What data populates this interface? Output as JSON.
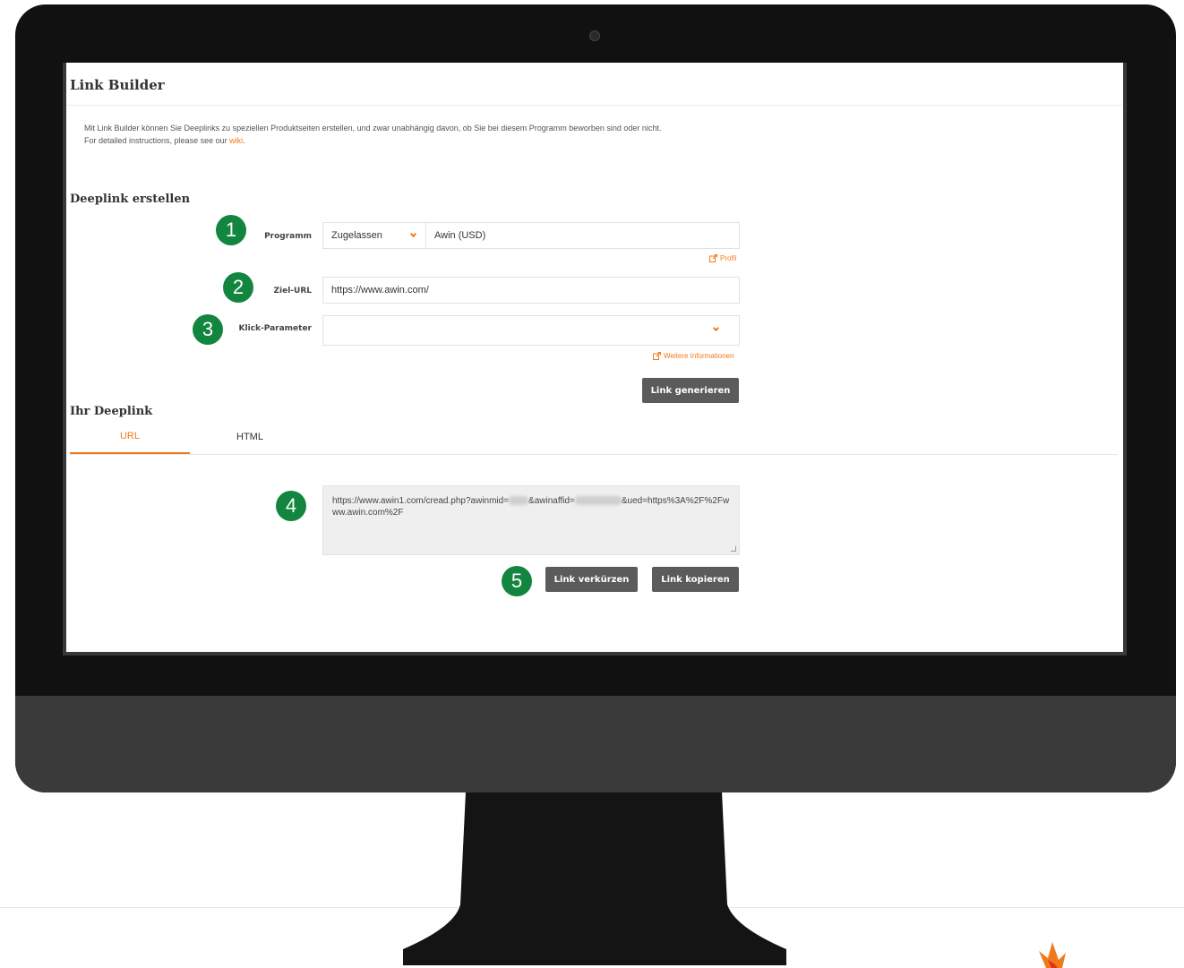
{
  "page": {
    "title": "Link Builder",
    "intro_line1": "Mit Link Builder können Sie Deeplinks zu speziellen Produktseiten erstellen, und zwar unabhängig davon, ob Sie bei diesem Programm beworben sind oder nicht.",
    "intro_line2_prefix": "For detailed instructions, please see our ",
    "intro_link": "wiki",
    "intro_line2_suffix": "."
  },
  "deeplink_form": {
    "heading": "Deeplink erstellen",
    "programm_label": "Programm",
    "programm_status": "Zugelassen",
    "programm_value": "Awin (USD)",
    "profil_link": "Profil",
    "ziel_url_label": "Ziel-URL",
    "ziel_url_value": "https://www.awin.com/",
    "klick_parameter_label": "Klick-Parameter",
    "klick_parameter_value": "",
    "weitere_info_link": "Weitere Informationen",
    "generate_button": "Link generieren"
  },
  "result": {
    "heading": "Ihr Deeplink",
    "tabs": [
      {
        "label": "URL",
        "active": true
      },
      {
        "label": "HTML",
        "active": false
      }
    ],
    "link_part1": "https://www.awin1.com/cread.php?awinmid=",
    "link_part2": "&awinaffid=",
    "link_part3": "&ued=https%3A%2F%2Fwww.awin.com%2F",
    "shorten_button": "Link verkürzen",
    "copy_button": "Link kopieren"
  },
  "step_badges": [
    "1",
    "2",
    "3",
    "4",
    "5"
  ],
  "colors": {
    "accent": "#f07a1b",
    "badge": "#12863f",
    "button": "#5b5b5b",
    "bezel": "#111111",
    "chin": "#3a3a3a"
  }
}
